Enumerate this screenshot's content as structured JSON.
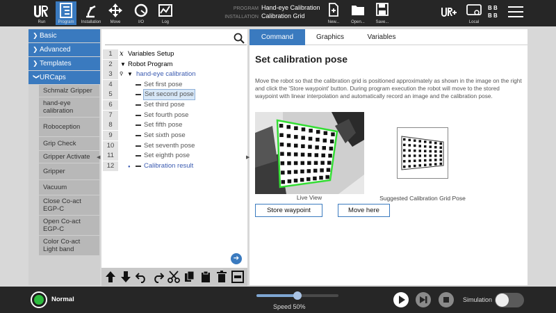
{
  "nav": {
    "run": "Run",
    "program": "Program",
    "installation": "Installation",
    "move": "Move",
    "io": "I/O",
    "log": "Log",
    "new": "New...",
    "open": "Open...",
    "save": "Save...",
    "local": "Local"
  },
  "program_info": {
    "program_key": "PROGRAM",
    "program_value": "Hand-eye Calibration",
    "installation_key": "INSTALLATION",
    "installation_value": "Calibration Grid"
  },
  "bb_labels": [
    "B",
    "B",
    "B",
    "B"
  ],
  "sidebar": {
    "categories": [
      {
        "label": "Basic",
        "chevron": "❯"
      },
      {
        "label": "Advanced",
        "chevron": "❯"
      },
      {
        "label": "Templates",
        "chevron": "❯"
      },
      {
        "label": "URCaps",
        "chevron": "❯"
      }
    ],
    "urcaps": [
      "Schmalz Gripper",
      "hand-eye calibration",
      "Roboception",
      "Grip Check",
      "Gripper Activate",
      "Gripper",
      "Vacuum",
      "Close Co-act EGP-C",
      "Open Co-act EGP-C",
      "Color Co-act Light band"
    ]
  },
  "tree": {
    "rows": [
      {
        "num": "1",
        "text": "Variables Setup"
      },
      {
        "num": "2",
        "text": "Robot Program"
      },
      {
        "num": "3",
        "text": "hand-eye calibration"
      },
      {
        "num": "4",
        "text": "Set first pose"
      },
      {
        "num": "5",
        "text": "Set second pose"
      },
      {
        "num": "6",
        "text": "Set third pose"
      },
      {
        "num": "7",
        "text": "Set fourth pose"
      },
      {
        "num": "8",
        "text": "Set fifth pose"
      },
      {
        "num": "9",
        "text": "Set sixth pose"
      },
      {
        "num": "10",
        "text": "Set seventh pose"
      },
      {
        "num": "11",
        "text": "Set eighth pose"
      },
      {
        "num": "12",
        "text": "Calibration result"
      }
    ]
  },
  "tabs": [
    "Command",
    "Graphics",
    "Variables"
  ],
  "command": {
    "title": "Set calibration pose",
    "description": "Move the robot so that the calibration grid is positioned approximately as shown in the image on the right and click the 'Store waypoint' button. During program execution the robot will move to the stored waypoint with linear interpolation and automatically record an image and the calibration pose.",
    "live_view_caption": "Live View",
    "suggested_caption": "Suggested Calibration Grid Pose",
    "store_button": "Store waypoint",
    "move_button": "Move here"
  },
  "bottom": {
    "status": "Normal",
    "speed_label": "Speed 50%",
    "speed_fraction": 0.5,
    "simulation_label": "Simulation"
  },
  "colors": {
    "accent": "#3a7abf",
    "status_ok": "#2dbb3e",
    "grid_outline": "#33dd33"
  }
}
